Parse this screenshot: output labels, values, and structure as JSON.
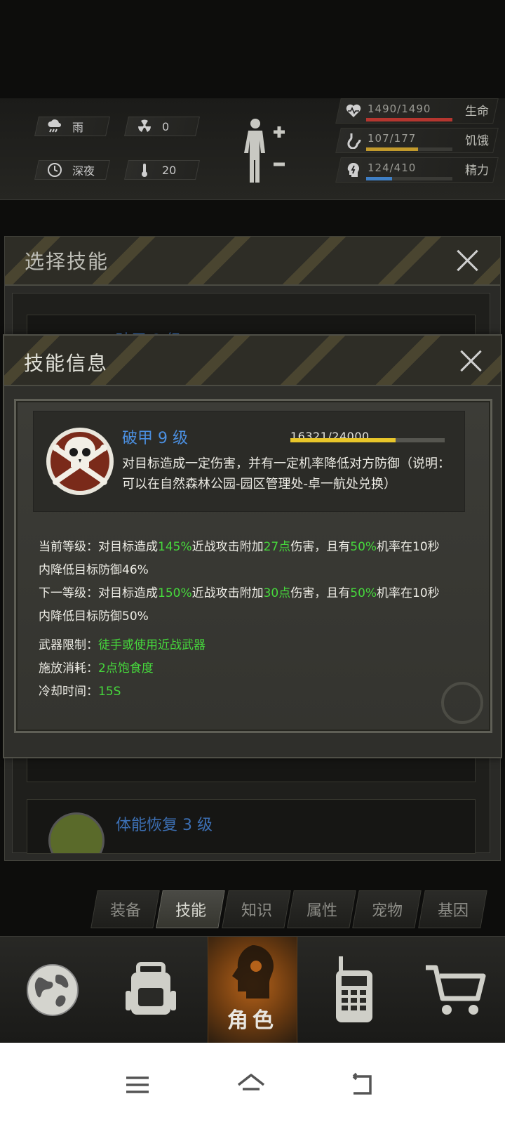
{
  "weather": {
    "condition": "雨",
    "radiation": "0",
    "time_of_day": "深夜",
    "temperature": "20"
  },
  "stats": [
    {
      "value": "1490/1490",
      "label": "生命",
      "fraction": 1.0,
      "color": "#b5362f",
      "icon": "heart-pulse-icon"
    },
    {
      "value": "107/177",
      "label": "饥饿",
      "fraction": 0.6,
      "color": "#c29a2c",
      "icon": "stomach-icon"
    },
    {
      "value": "124/410",
      "label": "精力",
      "fraction": 0.3,
      "color": "#3f7fc5",
      "icon": "energy-head-icon"
    }
  ],
  "select_panel": {
    "title": "选择技能",
    "items": [
      {
        "label": "破甲 9 级"
      },
      {
        "label": ""
      },
      {
        "label": "体能恢复 3 级"
      }
    ]
  },
  "dialog": {
    "title": "技能信息",
    "skill": {
      "name": "破甲 9 级",
      "exp": "16321/24000",
      "exp_fraction": 0.68,
      "description": "对目标造成一定伤害，并有一定机率降低对方防御（说明：可以在自然森林公园-园区管理处-卓一航处兑换）"
    },
    "current": {
      "prefix": "当前等级：对目标造成",
      "pct": "145%",
      "mid1": "近战攻击附加",
      "pts": "27点",
      "mid2": "伤害，且有",
      "chance": "50%",
      "suffix": "机率在10秒",
      "line2": "内降低目标防御46%"
    },
    "next": {
      "prefix": "下一等级：对目标造成",
      "pct": "150%",
      "mid1": "近战攻击附加",
      "pts": "30点",
      "mid2": "伤害，且有",
      "chance": "50%",
      "suffix": "机率在10秒",
      "line2": "内降低目标防御50%"
    },
    "weapon_label": "武器限制：",
    "weapon_value": "徒手或使用近战武器",
    "cost_label": "施放消耗：",
    "cost_value": "2点饱食度",
    "cooldown_label": "冷却时间：",
    "cooldown_value": "15S"
  },
  "tabs": [
    "装备",
    "技能",
    "知识",
    "属性",
    "宠物",
    "基因"
  ],
  "active_tab": "技能",
  "bottom_nav": {
    "active_label": "角色"
  }
}
